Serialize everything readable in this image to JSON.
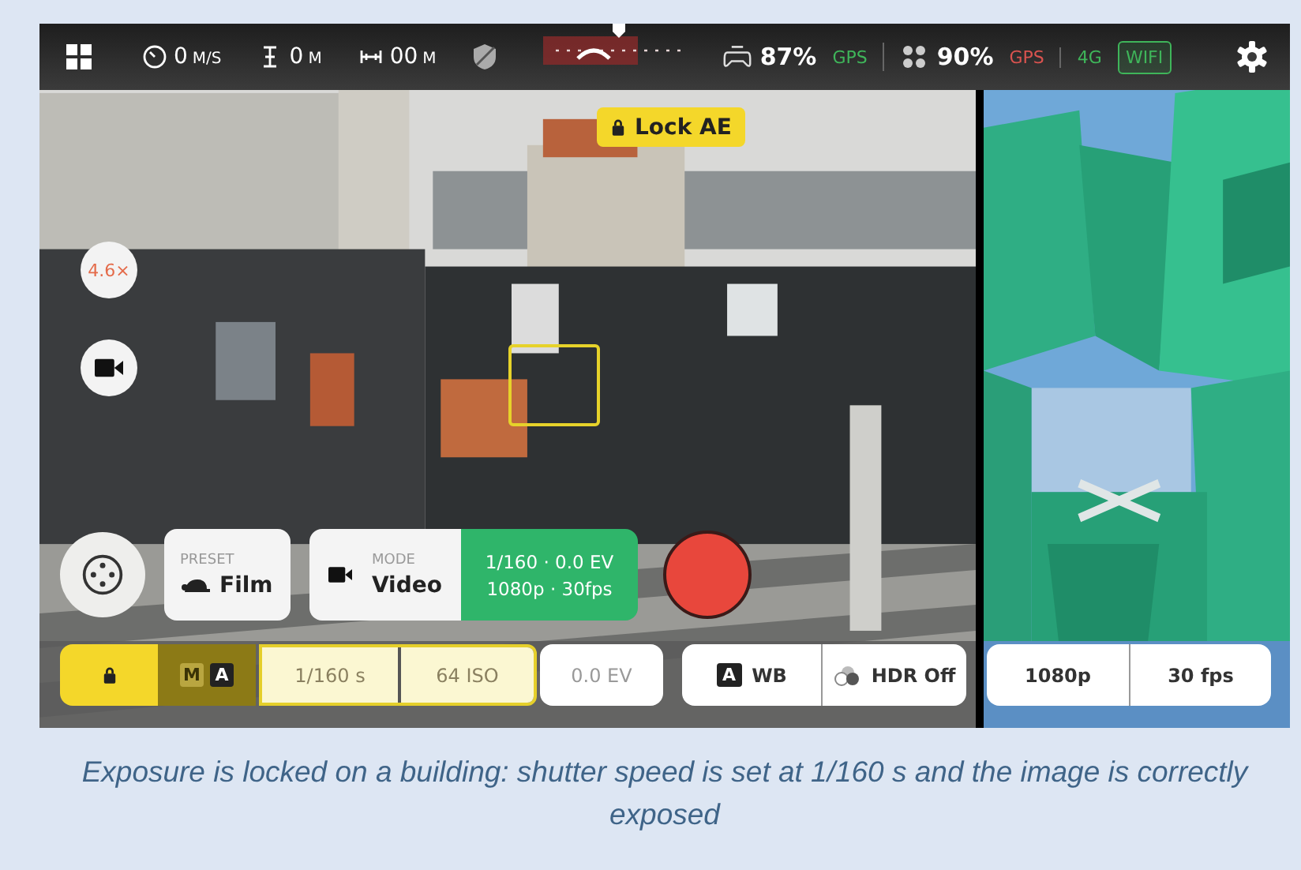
{
  "top_bar": {
    "telemetry": [
      {
        "kind": "speed",
        "value": "0",
        "unit": "M/S"
      },
      {
        "kind": "altitude",
        "value": "0",
        "unit": "M"
      },
      {
        "kind": "distance",
        "value": "00",
        "unit": "M"
      }
    ],
    "status": [
      {
        "kind": "controller",
        "value": "87%"
      },
      {
        "kind": "signal",
        "label": "GPS",
        "color": "#3fb55a"
      },
      {
        "kind": "drone",
        "value": "90%"
      },
      {
        "kind": "signal",
        "label": "GPS",
        "color": "#d9534f"
      },
      {
        "kind": "signal",
        "label": "4G",
        "color": "#3fb55a"
      },
      {
        "kind": "boxed",
        "label": "WIFI",
        "color": "#3fb55a"
      }
    ]
  },
  "lock_ae": {
    "label": "Lock AE"
  },
  "zoom_button": "4.6×",
  "preset": {
    "caption": "PRESET",
    "value": "Film"
  },
  "mode": {
    "caption": "MODE",
    "value": "Video"
  },
  "exposure_summary": [
    "1/160 · 0.0 EV",
    "1080p · 30fps"
  ],
  "exposure_bar": {
    "locked": true,
    "mode_options": [
      {
        "label": "M",
        "selected": false
      },
      {
        "label": "A",
        "selected": true
      }
    ],
    "shutter": "1/160 s",
    "iso": "64 ISO",
    "ev": "0.0 EV"
  },
  "white_balance": {
    "badge": "A",
    "label": "WB"
  },
  "hdr": "HDR Off",
  "video_bar": {
    "resolution": "1080p",
    "framerate": "30 fps"
  },
  "caption": "Exposure is locked on a building: shutter speed is set at 1/160 s and the image is correctly exposed"
}
